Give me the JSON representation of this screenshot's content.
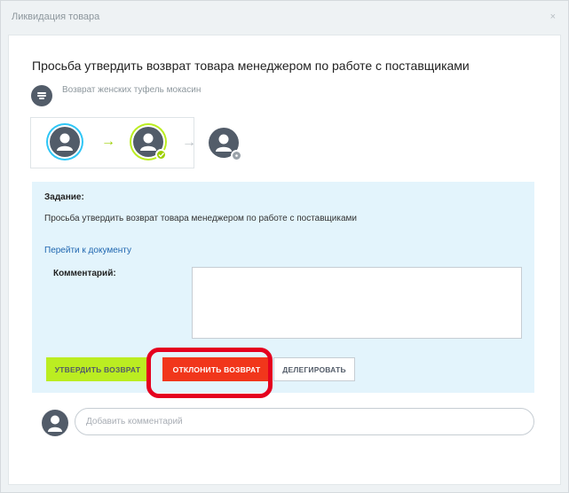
{
  "dialog": {
    "title": "Ликвидация товара",
    "close_glyph": "×"
  },
  "card": {
    "heading": "Просьба утвердить возврат товара менеджером по работе с поставщиками",
    "subtitle": "Возврат женских туфель мокасин",
    "subtitle_icon": "list-icon"
  },
  "workflow": {
    "steps": [
      {
        "icon": "user-avatar-icon",
        "state": "current",
        "ring_color": "#2fc6f6"
      },
      {
        "icon": "user-avatar-icon",
        "state": "approved",
        "ring_color": "#bbed21",
        "badge_color": "#9dcf00"
      },
      {
        "icon": "user-avatar-icon",
        "state": "pending",
        "badge_color": "#9aa2a9"
      }
    ],
    "arrow_glyph": "→",
    "arrow_colors": [
      "#9dcf00",
      "#b7bec3"
    ]
  },
  "task": {
    "heading": "Задание:",
    "text": "Просьба утвердить возврат товара менеджером по работе с поставщиками",
    "link": "Перейти к документу",
    "comment_label": "Комментарий:",
    "comment_value": ""
  },
  "buttons": {
    "approve": "УТВЕРДИТЬ ВОЗВРАТ",
    "decline": "ОТКЛОНИТЬ ВОЗВРАТ",
    "delegate": "ДЕЛЕГИРОВАТЬ"
  },
  "footer": {
    "comment_placeholder": "Добавить комментарий"
  },
  "colors": {
    "approve": "#bbed21",
    "decline": "#f1361b",
    "highlight": "#e5001f",
    "task_bg": "#e3f4fc",
    "avatar": "#525c69"
  }
}
